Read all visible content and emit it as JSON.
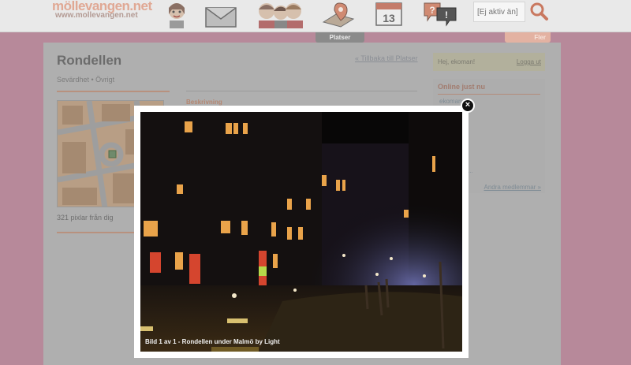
{
  "header": {
    "logo_main": "möllevangen.net",
    "logo_sub": "www.mollevangen.net",
    "nav_icons": [
      "girl-icon",
      "envelope-icon",
      "people-icon",
      "map-pin-icon",
      "calendar-icon",
      "help-icon"
    ],
    "calendar_day": "13",
    "search_placeholder": "[Ej aktiv än]"
  },
  "subnav": {
    "platser_label": "Platser",
    "fler_label": "Fler"
  },
  "place": {
    "title": "Rondellen",
    "subtitle": "Sevärdhet • Övrigt",
    "back_link": "« Tillbaka till Platser",
    "description_label": "Beskrivning",
    "distance": "321 pixlar från dig"
  },
  "sidebar": {
    "greeting": "Hej, ekoman!",
    "logout": "Logga ut",
    "online_title": "Online just nu",
    "online_user": "ekoman",
    "other_members": "Andra medlemmar »"
  },
  "lightbox": {
    "caption": "Bild 1 av 1 - Rondellen under Malmö by Light",
    "close": "×"
  }
}
